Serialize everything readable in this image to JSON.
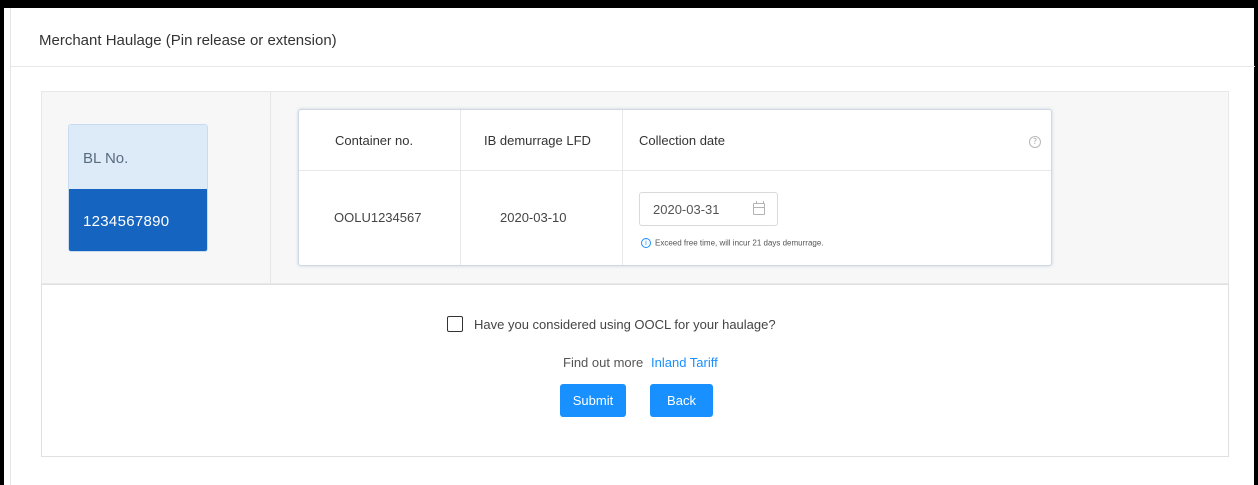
{
  "panel": {
    "title": "Merchant Haulage (Pin release or extension)"
  },
  "bl": {
    "label": "BL No.",
    "number": "1234567890"
  },
  "table": {
    "headers": [
      "Container no.",
      "IB demurrage LFD",
      "Collection date"
    ],
    "rows": [
      {
        "container_no": "OOLU1234567",
        "ib_demurrage_lfd": "2020-03-10",
        "collection_date": "2020-03-31",
        "hint": "Exceed free time, will incur 21 days demurrage."
      }
    ]
  },
  "icons": {
    "help": "?",
    "info": "i"
  },
  "haulage": {
    "checkbox_label": "Have you considered using OOCL for your haulage?",
    "checked": false,
    "find_out_text": "Find out more",
    "link_text": "Inland Tariff"
  },
  "buttons": {
    "submit": "Submit",
    "back": "Back"
  },
  "colors": {
    "primary": "#1890ff",
    "bl_number_bg": "#1565c0",
    "bl_label_bg": "#ddebf8"
  }
}
